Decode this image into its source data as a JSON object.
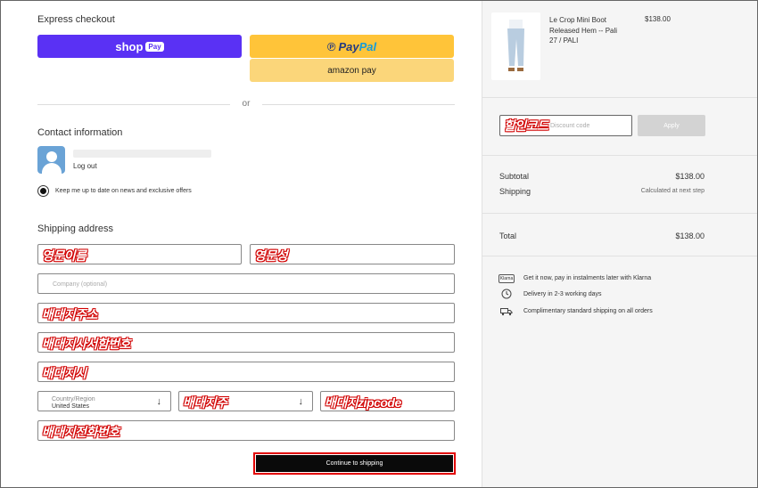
{
  "express": {
    "title": "Express checkout",
    "shop_label": "shop",
    "shop_badge": "Pay",
    "paypal_a": "Pay",
    "paypal_b": "Pal",
    "amazon_label": "amazon pay",
    "or_text": "or"
  },
  "contact": {
    "title": "Contact information",
    "logout": "Log out",
    "newsletter": "Keep me up to date on news and exclusive offers"
  },
  "shipping": {
    "title": "Shipping address",
    "first_name_overlay": "영문이름",
    "last_name_overlay": "영문성",
    "company_placeholder": "Company (optional)",
    "address_overlay": "배대지주소",
    "apt_overlay": "배대지사서함번호",
    "city_overlay": "배대지시",
    "country_label": "Country/Region",
    "country_value": "United States",
    "state_overlay": "배대지주",
    "zip_overlay": "배대지zipcode",
    "phone_overlay": "배대지전화번호",
    "continue_label": "Continue to shipping"
  },
  "order": {
    "product_name": "Le Crop Mini Boot Released Hem -- Pali",
    "product_variant": "27 / PALI",
    "product_price": "$138.00",
    "discount_overlay": "할인코드",
    "discount_placeholder": "Discount code",
    "apply_label": "Apply",
    "subtotal_label": "Subtotal",
    "subtotal_value": "$138.00",
    "shipping_label": "Shipping",
    "shipping_value": "Calculated at next step",
    "total_label": "Total",
    "total_value": "$138.00"
  },
  "benefits": [
    {
      "icon": "klarna-icon",
      "badge": "Klarna",
      "text": "Get it now, pay in instalments later with Klarna"
    },
    {
      "icon": "clock-icon",
      "text": "Delivery in 2-3 working days"
    },
    {
      "icon": "truck-icon",
      "text": "Complimentary standard shipping on all orders"
    }
  ],
  "colors": {
    "shop": "#5a31f4",
    "paypal": "#ffc439",
    "amazon": "#fbd67a",
    "annotation": "#d10000",
    "cta": "#0a0a0a"
  }
}
